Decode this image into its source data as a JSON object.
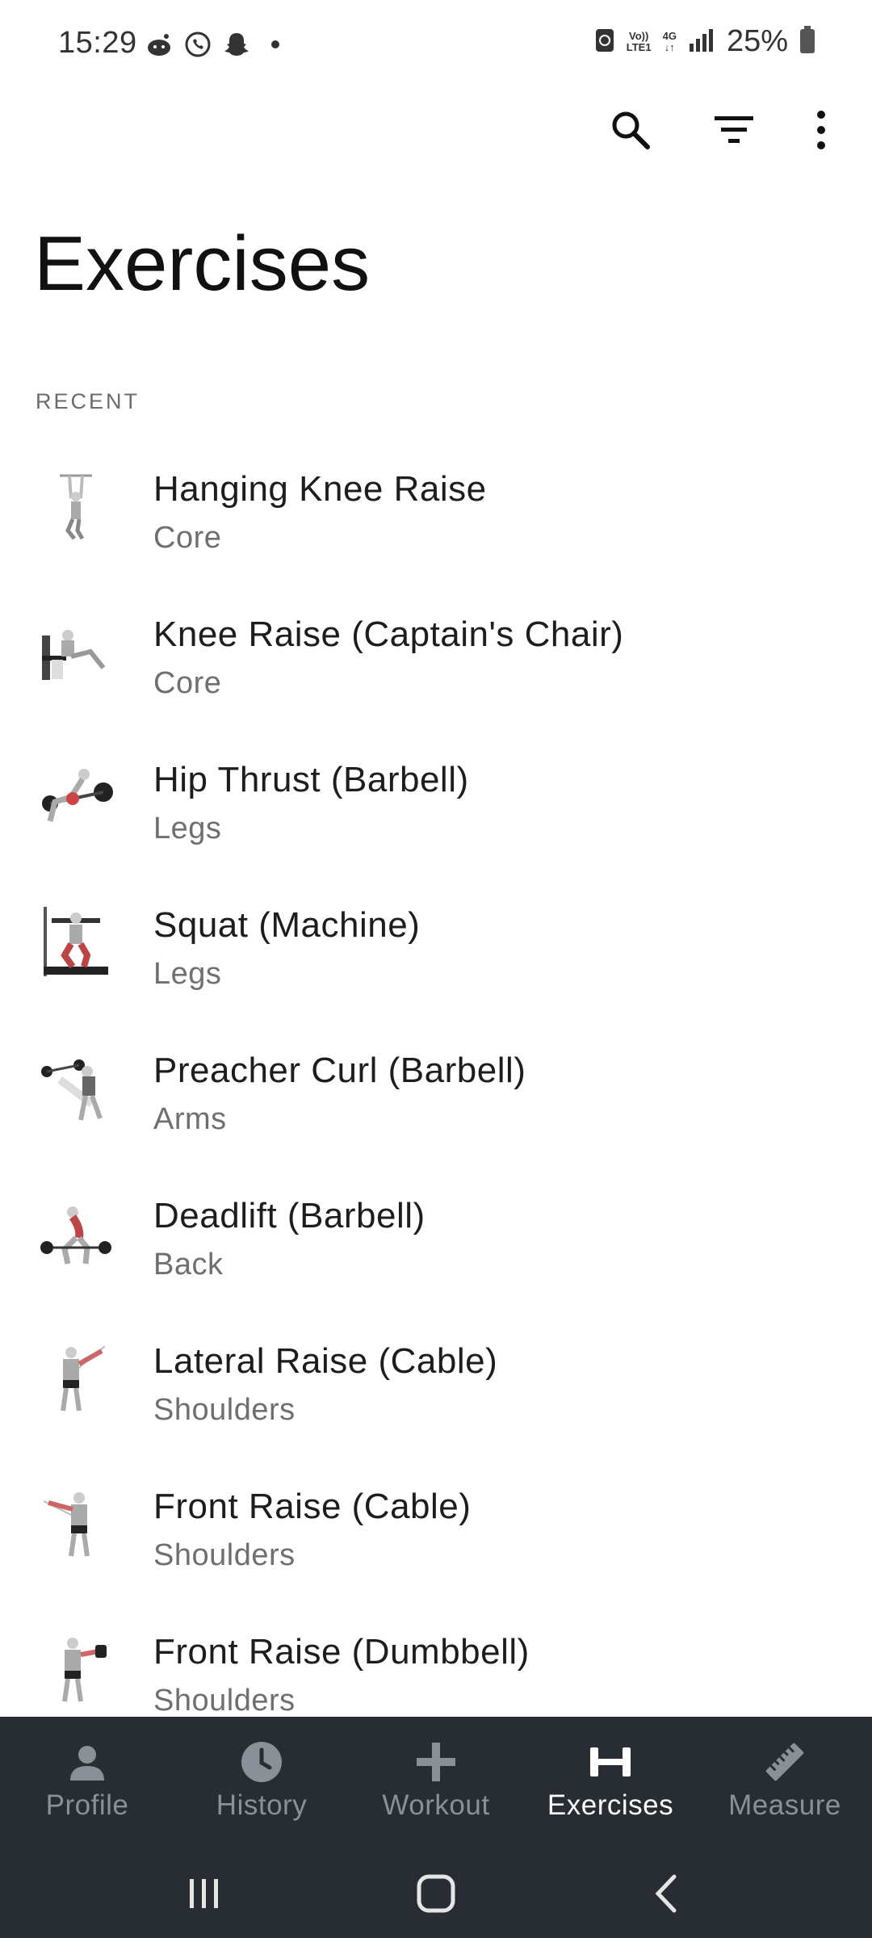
{
  "status_bar": {
    "time": "15:29",
    "battery": "25%",
    "network_top": "Vo))",
    "network_bottom": "LTE1",
    "network_type": "4G"
  },
  "page": {
    "title": "Exercises",
    "section_header": "RECENT"
  },
  "exercises": [
    {
      "name": "Hanging Knee Raise",
      "category": "Core"
    },
    {
      "name": "Knee Raise (Captain's Chair)",
      "category": "Core"
    },
    {
      "name": "Hip Thrust (Barbell)",
      "category": "Legs"
    },
    {
      "name": "Squat (Machine)",
      "category": "Legs"
    },
    {
      "name": "Preacher Curl (Barbell)",
      "category": "Arms"
    },
    {
      "name": "Deadlift (Barbell)",
      "category": "Back"
    },
    {
      "name": "Lateral Raise (Cable)",
      "category": "Shoulders"
    },
    {
      "name": "Front Raise (Cable)",
      "category": "Shoulders"
    },
    {
      "name": "Front Raise (Dumbbell)",
      "category": "Shoulders"
    }
  ],
  "bottom_nav": {
    "items": [
      {
        "label": "Profile",
        "icon": "person-icon"
      },
      {
        "label": "History",
        "icon": "clock-icon"
      },
      {
        "label": "Workout",
        "icon": "plus-icon"
      },
      {
        "label": "Exercises",
        "icon": "dumbbell-icon",
        "active": true
      },
      {
        "label": "Measure",
        "icon": "ruler-icon"
      }
    ]
  },
  "colors": {
    "nav_bg": "#282d33",
    "nav_inactive": "#8a9097",
    "nav_active": "#ffffff"
  }
}
